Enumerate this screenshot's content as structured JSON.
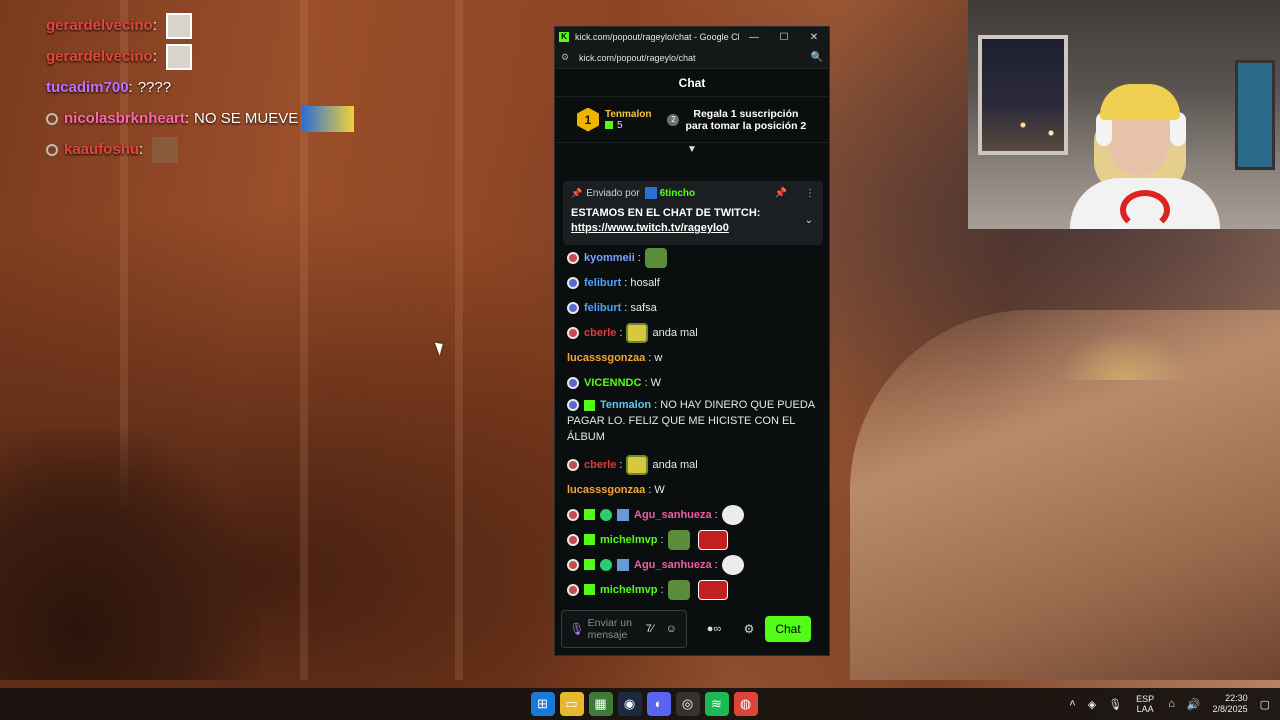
{
  "overlay_chat": [
    {
      "user": "gerardelvecino",
      "color": "#e2463c",
      "text": "",
      "emote": "emote"
    },
    {
      "user": "gerardelvecino",
      "color": "#e2463c",
      "text": "",
      "emote": "emote"
    },
    {
      "user": "tucadim700",
      "color": "#c070ff",
      "text": "????",
      "emote": ""
    },
    {
      "user": "nicolasbrknheart",
      "color": "#ff66aa",
      "text": "NO SE MUEVE",
      "emote": "wide"
    },
    {
      "user": "kaaufoshu",
      "color": "#e2463c",
      "text": "",
      "emote": "face"
    }
  ],
  "window": {
    "title": "kick.com/popout/rageylo/chat - Google Chro...",
    "url": "kick.com/popout/rageylo/chat",
    "minimize": "—",
    "maximize": "☐",
    "close": "✕"
  },
  "chat": {
    "header": "Chat",
    "leaderboard": {
      "rank1": "1",
      "user": "Tenmalon",
      "count": "5",
      "rank2": "2",
      "cta_line1": "Regala 1 suscripción",
      "cta_line2": "para tomar la posición 2"
    },
    "pinned": {
      "sent_by": "Enviado por",
      "user": "6tincho",
      "text": "ESTAMOS EN EL CHAT DE TWITCH:",
      "link": "https://www.twitch.tv/rageylo0"
    },
    "messages": [
      {
        "user": "kyommeii",
        "color": "#7aa2ff",
        "text": ""
      },
      {
        "user": "feliburt",
        "color": "#4aa3ff",
        "text": "hosalf"
      },
      {
        "user": "feliburt",
        "color": "#4aa3ff",
        "text": "safsa"
      },
      {
        "user": "cberle",
        "color": "#e03a3a",
        "text": "anda mal"
      },
      {
        "user": "lucasssgonzaa",
        "color": "#f4a535",
        "text": "w"
      },
      {
        "user": "VICENNDC",
        "color": "#53fc18",
        "text": "W"
      },
      {
        "user": "Tenmalon",
        "color": "#5ec8f0",
        "text": "NO HAY DINERO QUE PUEDA PAGAR LO. FELIZ QUE ME HICISTE CON EL ÁLBUM"
      },
      {
        "user": "cberle",
        "color": "#e03a3a",
        "text": "anda mal"
      },
      {
        "user": "lucasssgonzaa",
        "color": "#f4a535",
        "text": "W"
      },
      {
        "user": "Agu_sanhueza",
        "color": "#f15aa5",
        "text": ""
      },
      {
        "user": "michelmvp",
        "color": "#53fc18",
        "text": ""
      },
      {
        "user": "Agu_sanhueza",
        "color": "#f15aa5",
        "text": ""
      },
      {
        "user": "michelmvp",
        "color": "#53fc18",
        "text": ""
      }
    ],
    "input_placeholder": "Enviar un mensaje",
    "send_label": "Chat"
  },
  "taskbar": {
    "lang_line1": "ESP",
    "lang_line2": "LAA",
    "time": "22:30",
    "date": "2/8/2025"
  },
  "colors": {
    "kick_green": "#53fc18",
    "chat_bg": "#0b0e0f"
  }
}
